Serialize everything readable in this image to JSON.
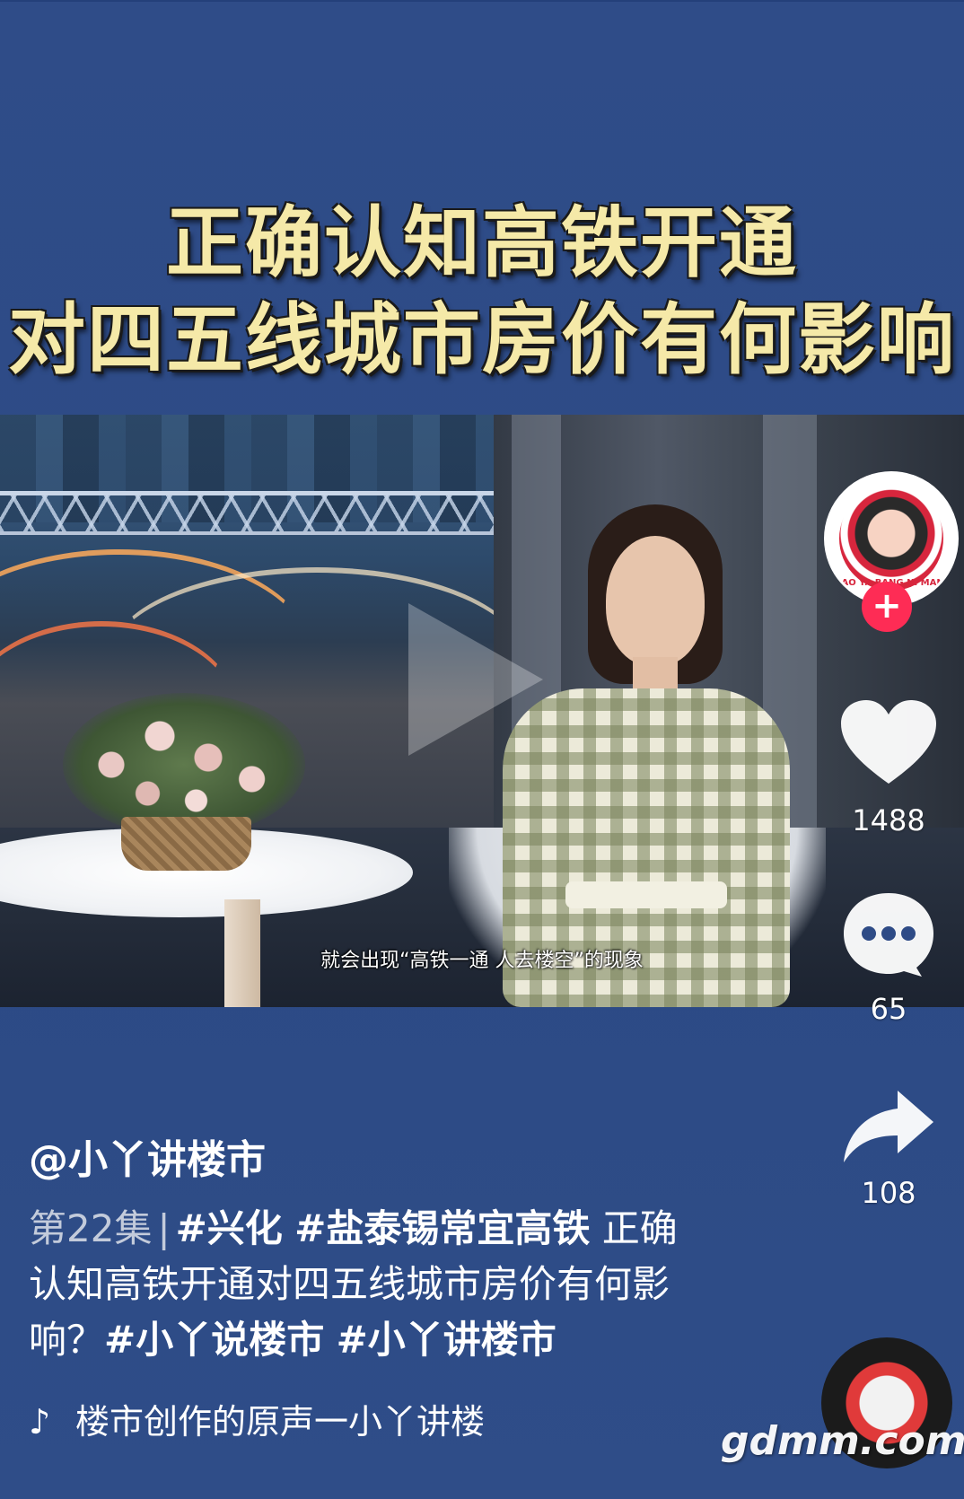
{
  "headline": {
    "line1": "正确认知高铁开通",
    "line2": "对四五线城市房价有何影响"
  },
  "video": {
    "subtitle": "就会出现“高铁一通 人去楼空”的现象"
  },
  "creator": {
    "avatar_text": "XIAO YA BANG NI MANG",
    "follow_symbol": "+"
  },
  "actions": {
    "likes": "1488",
    "comments": "65",
    "shares": "108"
  },
  "post": {
    "author": "@小丫讲楼市",
    "episode": "第22集",
    "separator": "|",
    "tags_inline": [
      "#兴化",
      "#盐泰锡常宜高铁"
    ],
    "text": "正确认知高铁开通对四五线城市房价有何影响？",
    "tags_trailing": [
      "#小丫说楼市",
      "#小丫讲楼市"
    ]
  },
  "music": {
    "note_icon": "♪",
    "title": "楼市创作的原声一小丫讲楼"
  },
  "watermark": "gdmm.com",
  "colors": {
    "background": "#2e4b86",
    "follow_button": "#fe2c55",
    "headline": "#f5e9a8"
  }
}
